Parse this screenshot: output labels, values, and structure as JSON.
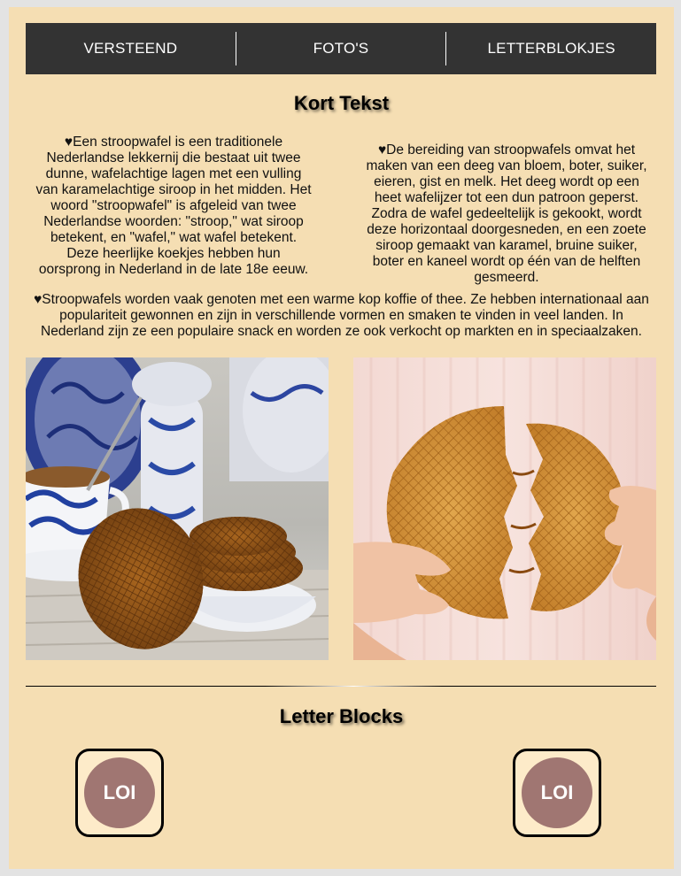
{
  "nav": {
    "items": [
      {
        "label": "VERSTEEND"
      },
      {
        "label": "FOTO'S"
      },
      {
        "label": "LETTERBLOKJES"
      }
    ]
  },
  "intro": {
    "title": "Kort Tekst",
    "paragraphs": [
      "♥Een stroopwafel is een traditionele Nederlandse lekkernij die bestaat uit twee dunne, wafelachtige lagen met een vulling van karamelachtige siroop in het midden. Het woord \"stroopwafel\" is afgeleid van twee Nederlandse woorden: \"stroop,\" wat siroop betekent, en \"wafel,\" wat wafel betekent. Deze heerlijke koekjes hebben hun oorsprong in Nederland in de late 18e eeuw.",
      "♥De bereiding van stroopwafels omvat het maken van een deeg van bloem, boter, suiker, eieren, gist en melk. Het deeg wordt op een heet wafelijzer tot een dun patroon geperst. Zodra de wafel gedeeltelijk is gekookt, wordt deze horizontaal doorgesneden, en een zoete siroop gemaakt van karamel, bruine suiker, boter en kaneel wordt op één van de helften gesmeerd.",
      "♥Stroopwafels worden vaak genoten met een warme kop koffie of thee. Ze hebben internationaal aan populariteit gewonnen en zijn in verschillende vormen en smaken te vinden in veel landen. In Nederland zijn ze een populaire snack en worden ze ook verkocht op markten en in speciaalzaken."
    ]
  },
  "photos": [
    {
      "icon": "stroopwafels-with-delft-blue-teacup-photo"
    },
    {
      "icon": "stroopwafel-broken-in-hands-photo"
    }
  ],
  "letter_blocks": {
    "title": "Letter Blocks",
    "blocks": [
      {
        "label": "LOI"
      },
      {
        "label": "LOI"
      }
    ]
  },
  "colors": {
    "page_background": "#f5deb3",
    "outer_background": "#e3e3e3",
    "nav_background": "#333333",
    "nav_text": "#ffffff",
    "block_background": "#fdebc9",
    "block_circle": "#a07672"
  }
}
